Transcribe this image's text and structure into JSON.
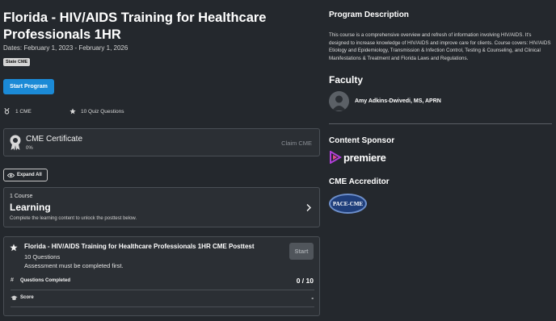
{
  "program": {
    "title": "Florida - HIV/AIDS Training for Healthcare Professionals 1HR",
    "dates": "Dates: February 1, 2023 - February 1, 2026",
    "tag": "State CME",
    "start_label": "Start Program",
    "cme_count": "1 CME",
    "quiz_count": "10 Quiz Questions"
  },
  "certificate": {
    "title": "CME Certificate",
    "progress": "0%",
    "claim_label": "Claim CME"
  },
  "expand_label": "Expand All",
  "learning": {
    "count": "1 Course",
    "title": "Learning",
    "desc": "Complete the learning content to unlock the posttest below."
  },
  "posttest": {
    "title": "Florida - HIV/AIDS Training for Healthcare Professionals 1HR CME Posttest",
    "questions": "10 Questions",
    "note": "Assessment must be completed first.",
    "start_label": "Start",
    "questions_completed_label": "Questions Completed",
    "questions_completed_value": "0 / 10",
    "score_label": "Score",
    "score_value": "-"
  },
  "description": {
    "heading": "Program Description",
    "text": "This course is a comprehensive overview and refresh of information involving HIV/AIDS. It's designed to increase knowledge of HIV/AIDS and improve care for clients. Course covers: HIV/AIDS Etiology and Epidemiology, Transmission & Infection Control, Testing & Counseling, and Clinical Manifestations & Treatment and Florida Laws and Regulations."
  },
  "faculty": {
    "heading": "Faculty",
    "name": "Amy Adkins-Dwivedi, MS, APRN"
  },
  "sponsor": {
    "heading": "Content Sponsor",
    "logo_text": "premiere"
  },
  "accreditor": {
    "heading": "CME Accreditor",
    "logo_text": "PACE-CME"
  },
  "colors": {
    "background": "#24282d",
    "primary_button": "#1b8ad6",
    "sponsor_accent": "#b03fd8"
  }
}
